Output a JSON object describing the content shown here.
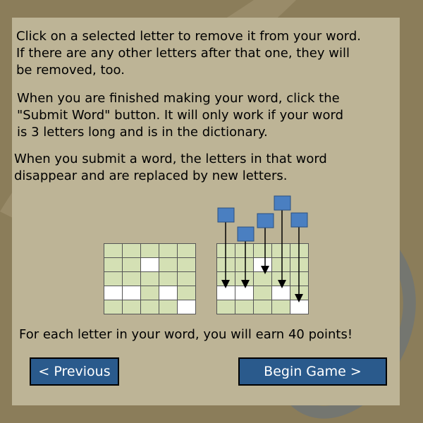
{
  "instructions": {
    "p1": "Click on a selected letter to remove it from your word.\nIf there are any other letters after that one, they will\nbe removed, too.",
    "p2": "When you are finished making your word, click the\n\"Submit Word\" button. It will only work if your word\nis 3 letters long and is in the dictionary.",
    "p3": "When you submit a word, the letters in that word\ndisappear and are replaced by new letters."
  },
  "diagram": {
    "left_grid_white_cells": [
      [
        1,
        2
      ],
      [
        3,
        0
      ],
      [
        3,
        1
      ],
      [
        3,
        3
      ],
      [
        4,
        4
      ]
    ],
    "right_grid_white_cells": [
      [
        1,
        2
      ],
      [
        3,
        0
      ],
      [
        3,
        1
      ],
      [
        3,
        3
      ],
      [
        4,
        4
      ]
    ],
    "colors": {
      "cell": "#d4e0b4",
      "cell_selected": "#ffffff",
      "tile": "#4a7fc1",
      "grid_line": "#555555"
    }
  },
  "points_text": "For each letter in your word, you will earn 40 points!",
  "buttons": {
    "previous": "< Previous",
    "begin": "Begin Game >"
  },
  "colors": {
    "background": "#8b7d5a",
    "panel": "#bdb496",
    "button": "#2a5a8c"
  }
}
